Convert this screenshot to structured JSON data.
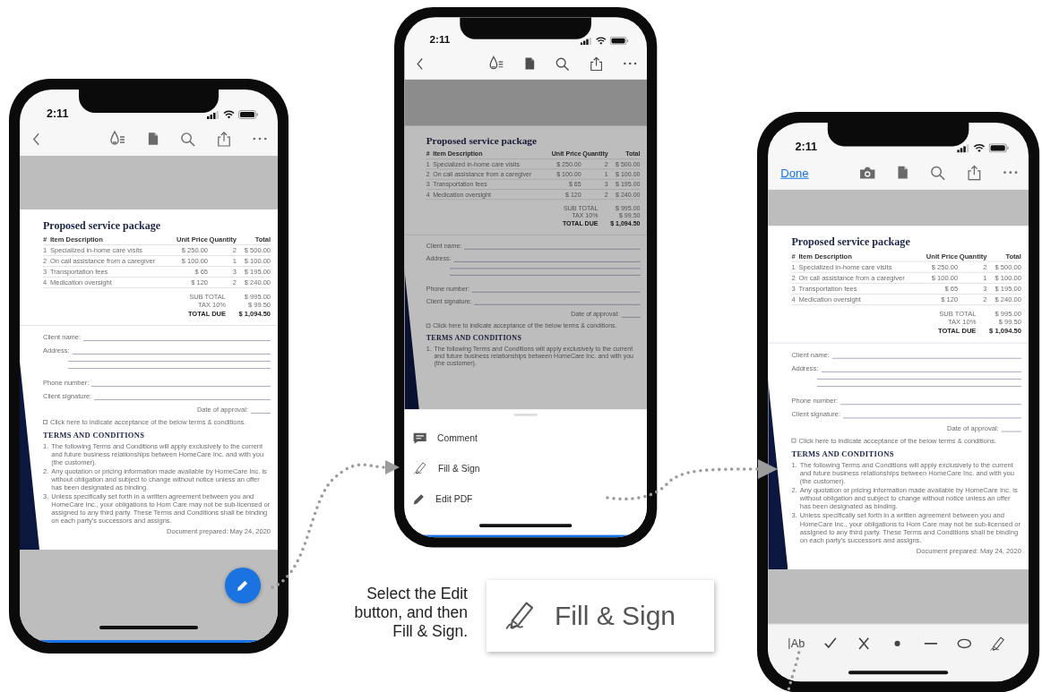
{
  "phones": [
    {
      "kind": "viewer",
      "time": "2:11",
      "document": {
        "title": "Proposed service package",
        "columns": [
          "#",
          "Item Description",
          "Unit Price",
          "Quantity",
          "Total"
        ],
        "rows": [
          [
            "1",
            "Specialized in-home care visits",
            "$ 250.00",
            "2",
            "$ 500.00"
          ],
          [
            "2",
            "On call assistance from a caregiver",
            "$ 100.00",
            "1",
            "$ 100.00"
          ],
          [
            "3",
            "Transportation fees",
            "$ 65",
            "3",
            "$ 195.00"
          ],
          [
            "4",
            "Medication oversight",
            "$ 120",
            "2",
            "$ 240.00"
          ]
        ],
        "totals": [
          {
            "label": "SUB TOTAL",
            "value": "$ 995.00"
          },
          {
            "label": "TAX 10%",
            "value": "$ 99.50"
          },
          {
            "label": "TOTAL DUE",
            "value": "$ 1,094.50"
          }
        ],
        "fields": [
          {
            "kind": "line",
            "label": "Client name:"
          },
          {
            "kind": "address",
            "label": "Address:"
          },
          {
            "kind": "line",
            "label": "Phone number:"
          },
          {
            "kind": "line",
            "label": "Client signature:"
          },
          {
            "kind": "short",
            "label": "Date of approval:"
          }
        ],
        "checkbox": {
          "label": "Click here to indicate acceptance of the below terms & conditions.",
          "checked": false
        },
        "terms_title": "TERMS AND CONDITIONS",
        "terms": [
          {
            "number": "1.",
            "text": "The following Terms and Conditions will apply exclusively to the current and future business relationships between HomeCare Inc. and with you (the customer)."
          },
          {
            "number": "2.",
            "text": "Any quotation or pricing information made available by HomeCare Inc. is without obligation and subject to change without notice unless an offer has been designated as binding."
          },
          {
            "number": "3.",
            "text": "Unless specifically set forth in a written agreement between you and HomeCare Inc., your obligations to Hom Care may not be sub-licensed or assigned to any third party. These Terms and Conditions shall be binding on each party's successors and assigns."
          }
        ],
        "footer": "Document prepared: May 24, 2020"
      }
    },
    {
      "kind": "menu",
      "time": "2:11",
      "document": {
        "title": "Proposed service package",
        "columns": [
          "#",
          "Item Description",
          "Unit Price",
          "Quantity",
          "Total"
        ],
        "rows": [
          [
            "1",
            "Specialized in-home care visits",
            "$ 250.00",
            "2",
            "$ 500.00"
          ],
          [
            "2",
            "On call assistance from a caregiver",
            "$ 100.00",
            "1",
            "$ 100.00"
          ],
          [
            "3",
            "Transportation fees",
            "$ 65",
            "3",
            "$ 195.00"
          ],
          [
            "4",
            "Medication oversight",
            "$ 120",
            "2",
            "$ 240.00"
          ]
        ],
        "totals": [
          {
            "label": "SUB TOTAL",
            "value": "$ 995.00"
          },
          {
            "label": "TAX 10%",
            "value": "$ 99.50"
          },
          {
            "label": "TOTAL DUE",
            "value": "$ 1,094.50"
          }
        ],
        "fields": [
          {
            "kind": "line",
            "label": "Client name:"
          },
          {
            "kind": "address",
            "label": "Address:"
          },
          {
            "kind": "line",
            "label": "Phone number:"
          },
          {
            "kind": "line",
            "label": "Client signature:"
          },
          {
            "kind": "short",
            "label": "Date of approval:"
          }
        ],
        "checkbox": {
          "label": "Click here to indicate acceptance of the below terms & conditions.",
          "checked": false
        },
        "terms_title": "TERMS AND CONDITIONS",
        "terms": [
          {
            "number": "1.",
            "text": "The following Terms and Conditions will apply exclusively to the current and future business relationships between HomeCare Inc. and with you (the customer)."
          }
        ]
      },
      "menu": [
        {
          "kind": "comment",
          "label": "Comment"
        },
        {
          "kind": "fill_sign",
          "label": "Fill & Sign"
        },
        {
          "kind": "edit",
          "label": "Edit PDF"
        }
      ]
    },
    {
      "kind": "fill_sign",
      "time": "2:11",
      "done_label": "Done",
      "document": {
        "title": "Proposed service package",
        "columns": [
          "#",
          "Item Description",
          "Unit Price",
          "Quantity",
          "Total"
        ],
        "rows": [
          [
            "1",
            "Specialized in-home care visits",
            "$ 250.00",
            "2",
            "$ 500.00"
          ],
          [
            "2",
            "On call assistance from a caregiver",
            "$ 100.00",
            "1",
            "$ 100.00"
          ],
          [
            "3",
            "Transportation fees",
            "$ 65",
            "3",
            "$ 195.00"
          ],
          [
            "4",
            "Medication oversight",
            "$ 120",
            "2",
            "$ 240.00"
          ]
        ],
        "totals": [
          {
            "label": "SUB TOTAL",
            "value": "$ 995.00"
          },
          {
            "label": "TAX 10%",
            "value": "$ 99.50"
          },
          {
            "label": "TOTAL DUE",
            "value": "$ 1,094.50"
          }
        ],
        "fields": [
          {
            "kind": "line",
            "label": "Client name:"
          },
          {
            "kind": "address",
            "label": "Address:"
          },
          {
            "kind": "line",
            "label": "Phone number:"
          },
          {
            "kind": "line",
            "label": "Client signature:"
          },
          {
            "kind": "short",
            "label": "Date of approval:"
          }
        ],
        "checkbox": {
          "label": "Click here to indicate acceptance of the below terms & conditions.",
          "checked": false
        },
        "terms_title": "TERMS AND CONDITIONS",
        "terms": [
          {
            "number": "1.",
            "text": "The following Terms and Conditions will apply exclusively to the current and future business relationships between HomeCare Inc. and with you (the customer)."
          },
          {
            "number": "2.",
            "text": "Any quotation or pricing information made available by HomeCare Inc. is without obligation and subject to change without notice unless an offer has been designated as binding."
          },
          {
            "number": "3.",
            "text": "Unless specifically set forth in a written agreement between you and HomeCare Inc., your obligations to Hom Care may not be sub-licensed or assigned to any third party. These Terms and Conditions shall be binding on each party's successors and assigns."
          }
        ],
        "footer": "Document prepared: May 24, 2020"
      },
      "tools": [
        {
          "kind": "text",
          "label": "Ab"
        },
        {
          "kind": "check"
        },
        {
          "kind": "cross"
        },
        {
          "kind": "dot"
        },
        {
          "kind": "line"
        },
        {
          "kind": "ellipse"
        },
        {
          "kind": "signature"
        }
      ]
    }
  ],
  "caption": "Select the Edit button, and then Fill & Sign.",
  "callout": {
    "kind": "fill_sign",
    "label": "Fill & Sign"
  }
}
